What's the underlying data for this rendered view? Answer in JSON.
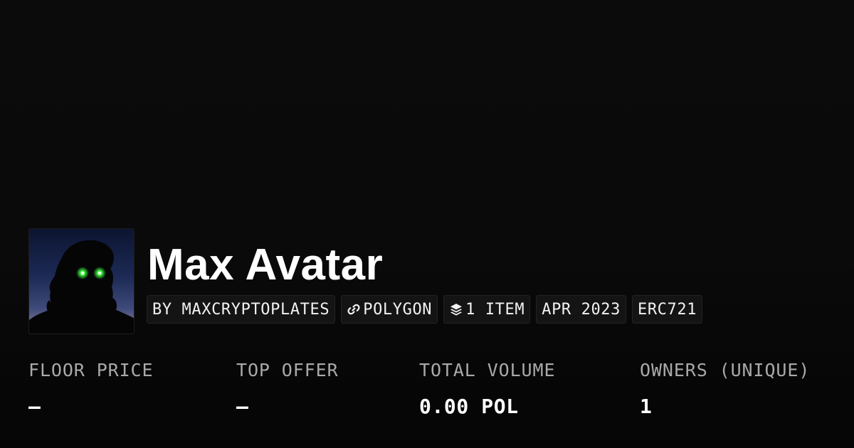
{
  "collection": {
    "name": "Max Avatar",
    "tags": {
      "creator": "BY MAXCRYPTOPLATES",
      "chain": "POLYGON",
      "items": "1 ITEM",
      "date": "APR 2023",
      "standard": "ERC721"
    },
    "icons": {
      "chain": "link-icon",
      "items": "layers-icon"
    }
  },
  "stats": {
    "floor_price": {
      "label": "FLOOR PRICE",
      "value": "—"
    },
    "top_offer": {
      "label": "TOP OFFER",
      "value": "—"
    },
    "total_volume": {
      "label": "TOTAL VOLUME",
      "value": "0.00 POL"
    },
    "owners": {
      "label": "OWNERS (UNIQUE)",
      "value": "1"
    }
  },
  "colors": {
    "background": "#0b0b0b",
    "tag_background": "#141414",
    "label_gray": "#a9a9a9",
    "text": "#ffffff",
    "eye_glow": "#3cff3c"
  }
}
